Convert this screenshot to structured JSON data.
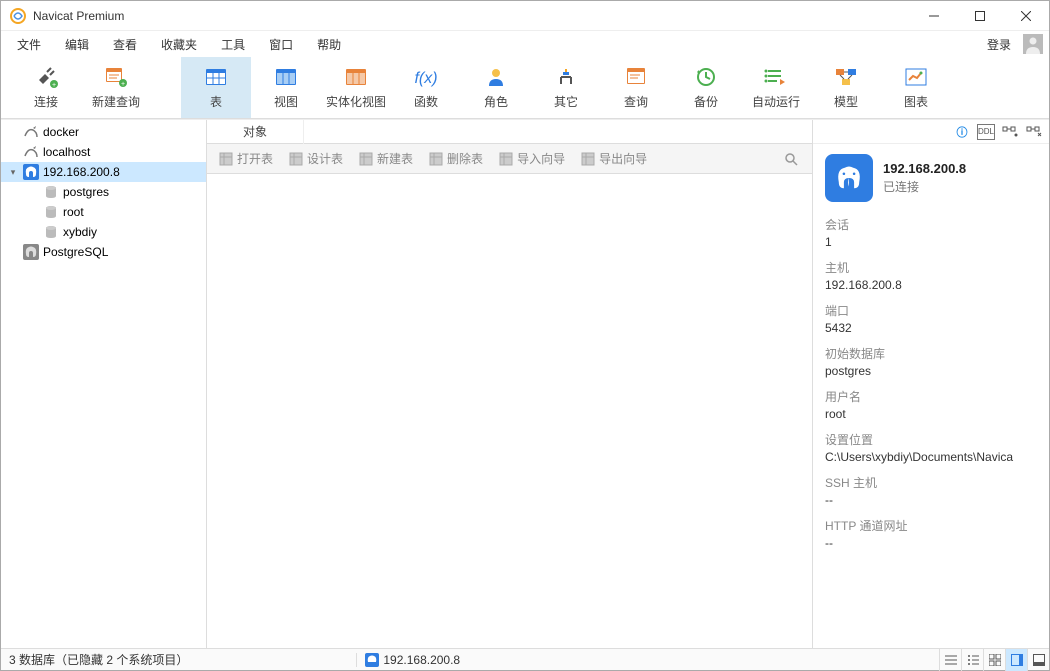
{
  "window": {
    "title": "Navicat Premium"
  },
  "menu": {
    "items": [
      "文件",
      "编辑",
      "查看",
      "收藏夹",
      "工具",
      "窗口",
      "帮助"
    ],
    "login": "登录"
  },
  "toolbar": {
    "items": [
      {
        "label": "连接",
        "icon": "plug-icon"
      },
      {
        "label": "新建查询",
        "icon": "new-query-icon"
      },
      {
        "label": "表",
        "icon": "table-icon",
        "selected": true
      },
      {
        "label": "视图",
        "icon": "view-icon"
      },
      {
        "label": "实体化视图",
        "icon": "materialized-view-icon"
      },
      {
        "label": "函数",
        "icon": "function-icon"
      },
      {
        "label": "角色",
        "icon": "role-icon"
      },
      {
        "label": "其它",
        "icon": "other-icon"
      },
      {
        "label": "查询",
        "icon": "query-icon"
      },
      {
        "label": "备份",
        "icon": "backup-icon"
      },
      {
        "label": "自动运行",
        "icon": "autorun-icon"
      },
      {
        "label": "模型",
        "icon": "model-icon"
      },
      {
        "label": "图表",
        "icon": "chart-icon"
      }
    ]
  },
  "tree": {
    "items": [
      {
        "label": "docker",
        "type": "mysql",
        "indent": 0
      },
      {
        "label": "localhost",
        "type": "mysql",
        "indent": 0
      },
      {
        "label": "192.168.200.8",
        "type": "postgres",
        "indent": 0,
        "selected": true,
        "expanded": true
      },
      {
        "label": "postgres",
        "type": "db",
        "indent": 1
      },
      {
        "label": "root",
        "type": "db",
        "indent": 1
      },
      {
        "label": "xybdiy",
        "type": "db",
        "indent": 1
      },
      {
        "label": "PostgreSQL",
        "type": "postgres-closed",
        "indent": 0
      }
    ]
  },
  "content": {
    "tab": "对象",
    "toolbar": [
      "打开表",
      "设计表",
      "新建表",
      "删除表",
      "导入向导",
      "导出向导"
    ]
  },
  "details": {
    "title": "192.168.200.8",
    "status": "已连接",
    "rows": [
      {
        "label": "会话",
        "value": "1"
      },
      {
        "label": "主机",
        "value": "192.168.200.8"
      },
      {
        "label": "端口",
        "value": "5432"
      },
      {
        "label": "初始数据库",
        "value": "postgres"
      },
      {
        "label": "用户名",
        "value": "root"
      },
      {
        "label": "设置位置",
        "value": "C:\\Users\\xybdiy\\Documents\\Navica"
      },
      {
        "label": "SSH 主机",
        "value": "--"
      },
      {
        "label": "HTTP 通道网址",
        "value": "--"
      }
    ]
  },
  "statusbar": {
    "left": "3 数据库（已隐藏 2 个系统项目）",
    "connection": "192.168.200.8"
  }
}
